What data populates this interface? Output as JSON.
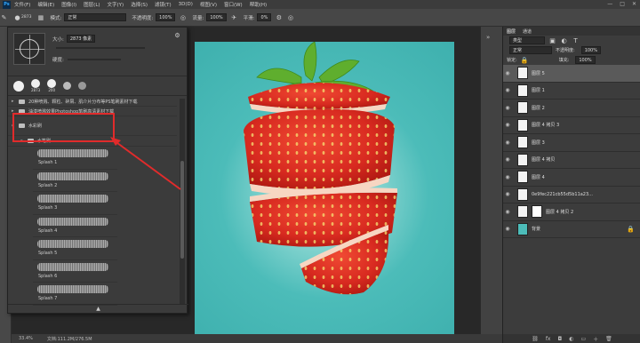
{
  "menubar": {
    "logo": "Ps",
    "items": [
      "文件(F)",
      "编辑(E)",
      "图像(I)",
      "图层(L)",
      "文字(Y)",
      "选择(S)",
      "滤镜(T)",
      "3D(D)",
      "视图(V)",
      "窗口(W)",
      "帮助(H)"
    ],
    "window_controls": [
      "—",
      "□",
      "✕"
    ]
  },
  "options": {
    "mode_label": "模式:",
    "mode_value": "正常",
    "opacity_label": "不透明度:",
    "opacity_value": "100%",
    "flow_label": "流量:",
    "flow_value": "100%",
    "smooth_label": "平滑:",
    "smooth_value": "0%",
    "brush_size": "2873"
  },
  "brush_panel": {
    "size_label": "大小:",
    "size_value": "2873 像素",
    "hardness_label": "硬度:",
    "presets": [
      {
        "text": "2873"
      },
      {
        "text": "200"
      }
    ],
    "folders": [
      {
        "label": "20种喷溅、颗粒、碎屑、肌介片分布等PS笔刷素材下载",
        "expanded": false
      },
      {
        "label": "油漆喷溅效果Photoshop笔刷高清素材下载",
        "expanded": false
      },
      {
        "label": "水彩刷",
        "expanded": true
      },
      {
        "label": "水笔刷",
        "expanded": true
      }
    ],
    "brushes": [
      "Splash 1",
      "Splash 2",
      "Splash 3",
      "Splash 4",
      "Splash 5",
      "Splash 6",
      "Splash 7"
    ]
  },
  "status": {
    "zoom": "33.4%",
    "doc_info": "文档:111.2M/276.5M"
  },
  "layers_panel": {
    "tabs": [
      "图层",
      "通道"
    ],
    "filter_label": "类型",
    "blend_mode": "正常",
    "opacity_label": "不透明度:",
    "opacity_value": "100%",
    "lock_label": "锁定:",
    "fill_label": "填充:",
    "fill_value": "100%",
    "layers": [
      {
        "name": "图层 5"
      },
      {
        "name": "图层 1"
      },
      {
        "name": "图层 2"
      },
      {
        "name": "图层 4 拷贝 3"
      },
      {
        "name": "图层 3"
      },
      {
        "name": "图层 4 拷贝"
      },
      {
        "name": "图层 4"
      },
      {
        "name": "0e9fec221cb55d5b11a23..."
      },
      {
        "name": "图层 4 拷贝 2"
      },
      {
        "name": "背景"
      }
    ],
    "footer_icons": [
      "链接",
      "fx",
      "蒙版",
      "调整",
      "组",
      "新建",
      "删除"
    ]
  },
  "colors": {
    "accent_red": "#e12b2b",
    "canvas_teal": "#4cbcb9",
    "strawberry_red": "#d82a20"
  }
}
